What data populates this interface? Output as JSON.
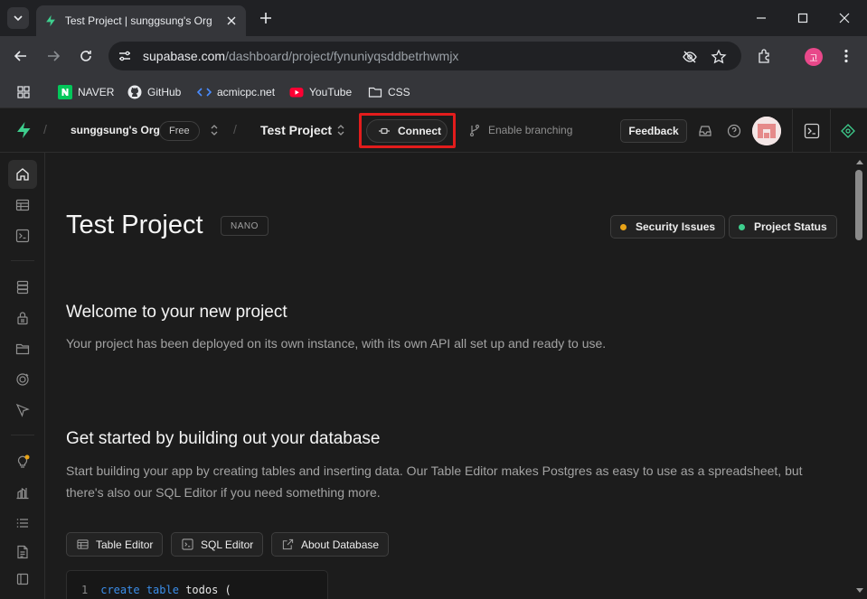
{
  "browser": {
    "tab_title": "Test Project | sunggsung's Org",
    "url_host": "supabase.com",
    "url_path": "/dashboard/project/fynuniyqsddbetrhwmjx",
    "profile_initial": "고",
    "bookmarks": [
      {
        "label": "NAVER",
        "icon": "naver-icon"
      },
      {
        "label": "GitHub",
        "icon": "github-icon"
      },
      {
        "label": "acmicpc.net",
        "icon": "code-icon"
      },
      {
        "label": "YouTube",
        "icon": "youtube-icon"
      },
      {
        "label": "CSS",
        "icon": "folder-icon"
      }
    ]
  },
  "header": {
    "org_name": "sunggsung's Org",
    "plan": "Free",
    "project_name": "Test Project",
    "connect_label": "Connect",
    "branching_label": "Enable branching",
    "feedback_label": "Feedback"
  },
  "sidebar": {
    "items": [
      {
        "name": "home",
        "icon": "home-icon",
        "active": true
      },
      {
        "name": "table-editor",
        "icon": "table-icon"
      },
      {
        "name": "sql-editor",
        "icon": "terminal-icon"
      },
      {
        "name": "database",
        "icon": "database-icon"
      },
      {
        "name": "authentication",
        "icon": "lock-icon"
      },
      {
        "name": "storage",
        "icon": "storage-icon"
      },
      {
        "name": "realtime",
        "icon": "realtime-icon"
      },
      {
        "name": "edge-functions",
        "icon": "cursor-icon"
      },
      {
        "name": "advisors",
        "icon": "lightbulb-icon"
      },
      {
        "name": "reports",
        "icon": "chart-icon"
      },
      {
        "name": "logs",
        "icon": "list-icon"
      },
      {
        "name": "api-docs",
        "icon": "doc-icon"
      },
      {
        "name": "collapse",
        "icon": "panel-icon"
      }
    ]
  },
  "main": {
    "title": "Test Project",
    "compute_badge": "NANO",
    "security_label": "Security Issues",
    "status_label": "Project Status",
    "colors": {
      "security_dot": "#e8a317",
      "status_dot": "#3ecf8e"
    },
    "welcome_heading": "Welcome to your new project",
    "welcome_text": "Your project has been deployed on its own instance, with its own API all set up and ready to use.",
    "started_heading": "Get started by building out your database",
    "started_text": "Start building your app by creating tables and inserting data. Our Table Editor makes Postgres as easy to use as a spreadsheet, but there's also our SQL Editor if you need something more.",
    "buttons": {
      "table_editor": "Table Editor",
      "sql_editor": "SQL Editor",
      "about_database": "About Database"
    },
    "code": {
      "line_number": "1",
      "kw1": "create",
      "kw2": "table",
      "ident": "todos ("
    }
  }
}
